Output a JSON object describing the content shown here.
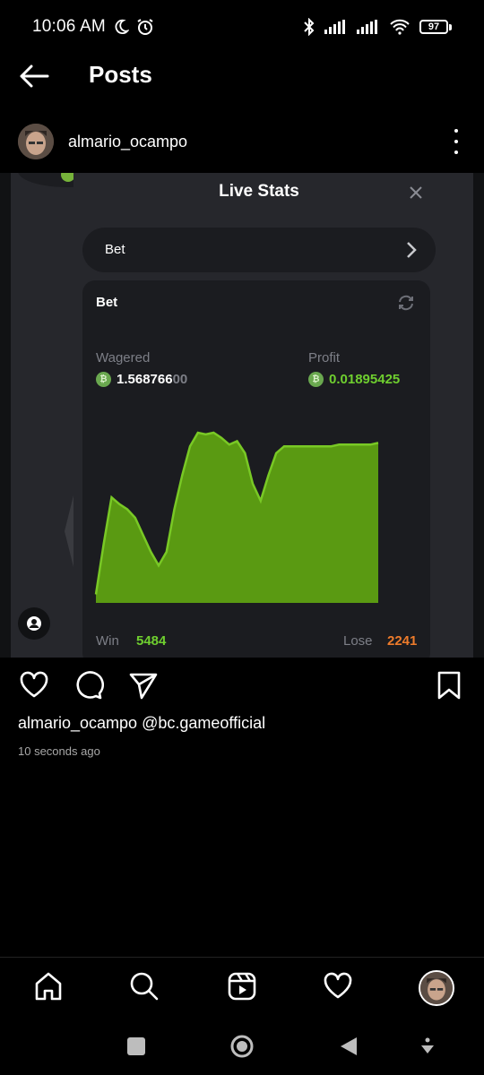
{
  "status_bar": {
    "time": "10:06 AM",
    "battery": "97"
  },
  "header": {
    "title": "Posts"
  },
  "post": {
    "username": "almario_ocampo",
    "caption_user": "almario_ocampo",
    "caption_text": "@bc.gameofficial",
    "timestamp": "10 seconds ago"
  },
  "live_stats": {
    "title": "Live Stats",
    "select_label": "Bet",
    "card_title": "Bet",
    "wagered_label": "Wagered",
    "wagered_value_bright": "1.568766",
    "wagered_value_dim": "00",
    "profit_label": "Profit",
    "profit_value": "0.01895425",
    "win_label": "Win",
    "win_value": "5484",
    "lose_label": "Lose",
    "lose_value": "2241"
  },
  "chart_data": {
    "type": "area",
    "title": "",
    "xlabel": "",
    "ylabel": "",
    "series": [
      {
        "values": [
          0.05,
          0.35,
          0.62,
          0.58,
          0.55,
          0.5,
          0.4,
          0.3,
          0.22,
          0.3,
          0.55,
          0.75,
          0.92,
          1.0,
          0.99,
          1.0,
          0.97,
          0.93,
          0.95,
          0.88,
          0.7,
          0.6,
          0.75,
          0.88,
          0.92,
          0.92,
          0.92,
          0.92,
          0.92,
          0.92,
          0.92,
          0.93,
          0.93,
          0.93,
          0.93,
          0.93,
          0.94
        ]
      }
    ],
    "colors": {
      "fill": "#5a9a12",
      "stroke": "#79c925"
    }
  },
  "theme": {
    "accent_green": "#6fcf2f",
    "accent_orange": "#ed7b2b",
    "modal_bg": "#26272c",
    "card_bg": "#1b1c20"
  },
  "icons": {
    "back": "arrow-left-icon",
    "more": "more-vertical-icon",
    "like": "heart-icon",
    "comment": "comment-icon",
    "share": "send-icon",
    "save": "bookmark-icon"
  }
}
